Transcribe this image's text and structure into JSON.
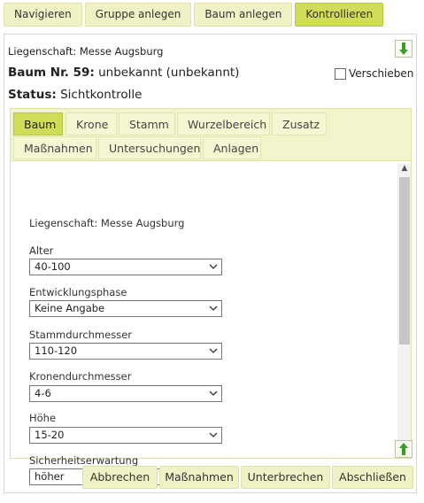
{
  "nav": {
    "buttons": [
      "Navigieren",
      "Gruppe anlegen",
      "Baum anlegen",
      "Kontrollieren"
    ],
    "active": "Kontrollieren"
  },
  "header": {
    "property_line": "Liegenschaft: Messe Augsburg",
    "tree_label": "Baum Nr. 59:",
    "tree_value": "unbekannt (unbekannt)",
    "status_label": "Status:",
    "status_value": "Sichtkontrolle",
    "move_label": "Verschieben",
    "move_checked": false
  },
  "tabs": {
    "row1": [
      "Baum",
      "Krone",
      "Stamm",
      "Wurzelbereich",
      "Zusatz"
    ],
    "row2": [
      "Maßnahmen",
      "Untersuchungen",
      "Anlagen"
    ],
    "active": "Baum"
  },
  "form": {
    "property_line": "Liegenschaft: Messe Augsburg",
    "fields": [
      {
        "label": "Alter",
        "value": "40-100"
      },
      {
        "label": "Entwicklungsphase",
        "value": "Keine Angabe"
      },
      {
        "label": "Stammdurchmesser",
        "value": "110-120"
      },
      {
        "label": "Kronendurchmesser",
        "value": "4-6"
      },
      {
        "label": "Höhe",
        "value": "15-20"
      },
      {
        "label": "Sicherheitserwartung",
        "value": "höher"
      }
    ]
  },
  "footer": {
    "buttons": [
      "Abbrechen",
      "Maßnahmen",
      "Unterbrechen",
      "Abschließen"
    ]
  },
  "colors": {
    "accent": "#cfdc59",
    "button_bg": "#f0f2c6",
    "arrow_green": "#3a9a2a"
  }
}
